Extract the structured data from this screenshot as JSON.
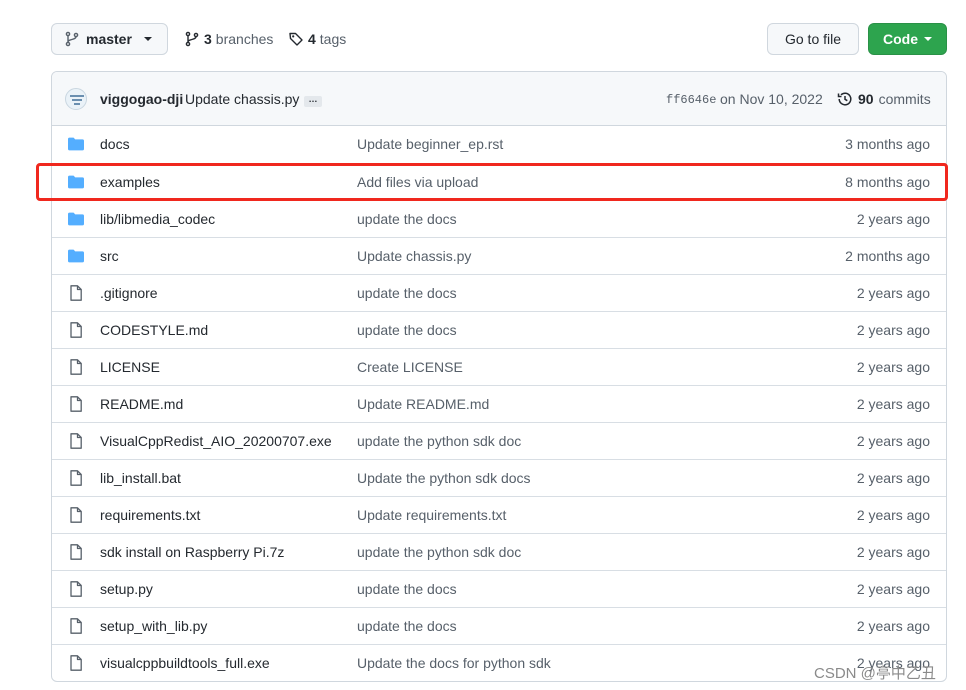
{
  "toolbar": {
    "branch": "master",
    "branches_count": "3",
    "branches_label": "branches",
    "tags_count": "4",
    "tags_label": "tags",
    "goto_file_label": "Go to file",
    "code_label": "Code"
  },
  "commit": {
    "author": "viggogao-dji",
    "message": "Update chassis.py",
    "ellipsis": "…",
    "sha": "ff6646e",
    "date": "on Nov 10, 2022",
    "count": "90",
    "count_label": "commits"
  },
  "files": [
    {
      "type": "dir",
      "name": "docs",
      "message": "Update beginner_ep.rst",
      "age": "3 months ago"
    },
    {
      "type": "dir",
      "name": "examples",
      "message": "Add files via upload",
      "age": "8 months ago",
      "highlighted": true
    },
    {
      "type": "dir",
      "name": "lib/libmedia_codec",
      "message": "update the docs",
      "age": "2 years ago"
    },
    {
      "type": "dir",
      "name": "src",
      "message": "Update chassis.py",
      "age": "2 months ago"
    },
    {
      "type": "file",
      "name": ".gitignore",
      "message": "update the docs",
      "age": "2 years ago"
    },
    {
      "type": "file",
      "name": "CODESTYLE.md",
      "message": "update the docs",
      "age": "2 years ago"
    },
    {
      "type": "file",
      "name": "LICENSE",
      "message": "Create LICENSE",
      "age": "2 years ago"
    },
    {
      "type": "file",
      "name": "README.md",
      "message": "Update README.md",
      "age": "2 years ago"
    },
    {
      "type": "file",
      "name": "VisualCppRedist_AIO_20200707.exe",
      "message": "update the python sdk doc",
      "age": "2 years ago"
    },
    {
      "type": "file",
      "name": "lib_install.bat",
      "message": "Update the python sdk docs",
      "age": "2 years ago"
    },
    {
      "type": "file",
      "name": "requirements.txt",
      "message": "Update requirements.txt",
      "age": "2 years ago"
    },
    {
      "type": "file",
      "name": "sdk install on Raspberry Pi.7z",
      "message": "update the python sdk doc",
      "age": "2 years ago"
    },
    {
      "type": "file",
      "name": "setup.py",
      "message": "update the docs",
      "age": "2 years ago"
    },
    {
      "type": "file",
      "name": "setup_with_lib.py",
      "message": "update the docs",
      "age": "2 years ago"
    },
    {
      "type": "file",
      "name": "visualcppbuildtools_full.exe",
      "message": "Update the docs for python sdk",
      "age": "2 years ago"
    }
  ],
  "watermark": "CSDN @亭中乙丑",
  "colors": {
    "folder": "#54aeff",
    "file_icon": "#57606a",
    "code_button": "#2da44e",
    "highlight_border": "#f0281e"
  },
  "icons": {
    "branch": "git-branch-icon",
    "tag": "tag-icon",
    "history": "history-icon",
    "folder": "folder-icon",
    "file": "file-icon"
  }
}
